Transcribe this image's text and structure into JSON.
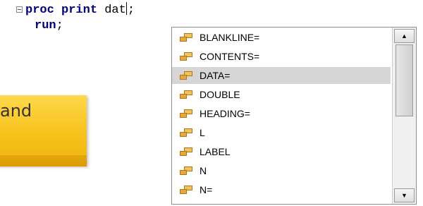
{
  "editor": {
    "line1": {
      "keyword": "proc print",
      "typed": "dat",
      "after_caret": ";"
    },
    "line2": {
      "keyword": "run",
      "rest": ";"
    }
  },
  "callout": {
    "text": "and"
  },
  "autocomplete": {
    "selected_index": 2,
    "items": [
      {
        "label": "BLANKLINE=",
        "icon": "option-icon"
      },
      {
        "label": "CONTENTS=",
        "icon": "option-icon"
      },
      {
        "label": "DATA=",
        "icon": "option-icon"
      },
      {
        "label": "DOUBLE",
        "icon": "option-icon"
      },
      {
        "label": "HEADING=",
        "icon": "option-icon"
      },
      {
        "label": "L",
        "icon": "option-icon"
      },
      {
        "label": "LABEL",
        "icon": "option-icon"
      },
      {
        "label": "N",
        "icon": "option-icon"
      },
      {
        "label": "N=",
        "icon": "option-icon"
      }
    ],
    "scrollbar": {
      "up_glyph": "▲",
      "down_glyph": "▼"
    }
  }
}
